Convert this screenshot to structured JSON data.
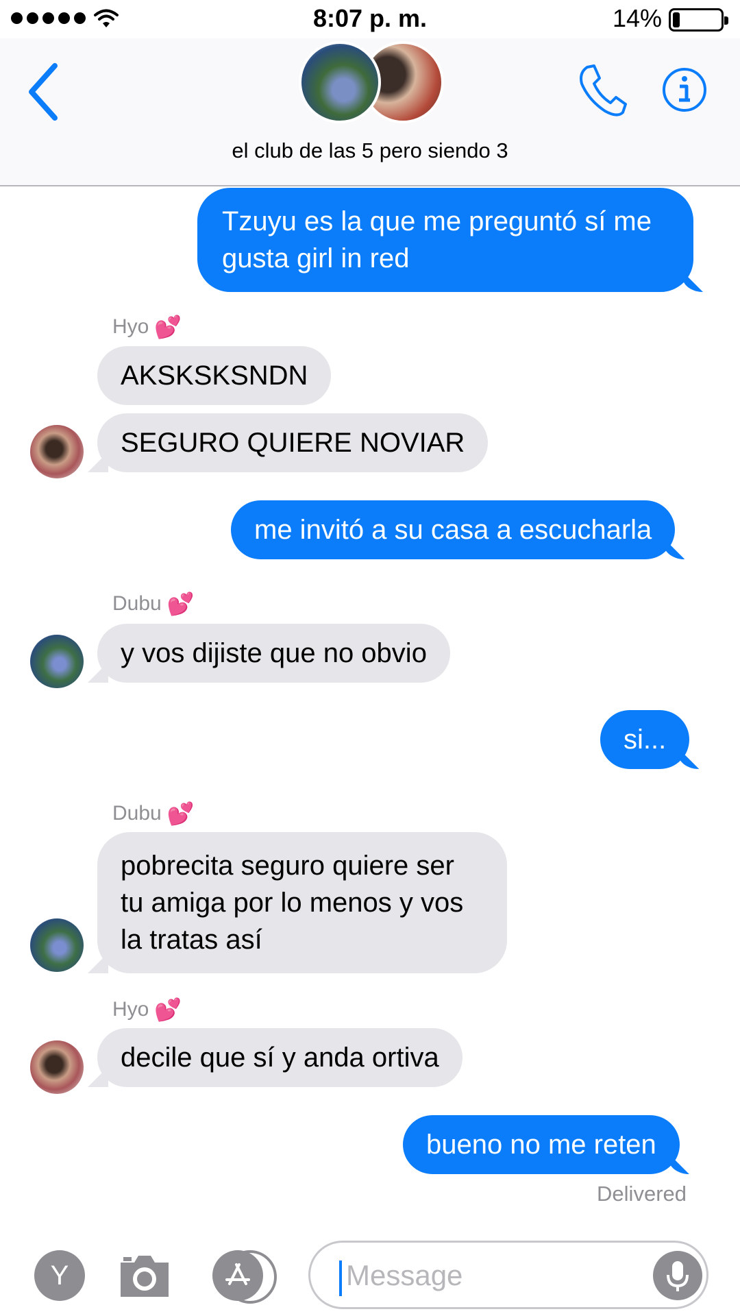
{
  "status_bar": {
    "time": "8:07 p. m.",
    "battery_percent": "14%",
    "battery_level": 0.14,
    "signal_dots": 5,
    "wifi_icon": "wifi-icon"
  },
  "header": {
    "group_name": "el club de las 5 pero siendo 3",
    "back_icon": "chevron-left-icon",
    "call_icon": "phone-icon",
    "info_icon": "info-icon",
    "accent_color": "#0b7dfb"
  },
  "messages": [
    {
      "direction": "outgoing",
      "text": "Tzuyu es la que me preguntó sí me gusta girl in red"
    },
    {
      "direction": "incoming",
      "sender": "Hyo",
      "text": "AKSKSKSNDN"
    },
    {
      "direction": "incoming",
      "sender": "Hyo",
      "text": "SEGURO QUIERE NOVIAR"
    },
    {
      "direction": "outgoing",
      "text": "me invitó a su casa a escucharla"
    },
    {
      "direction": "incoming",
      "sender": "Dubu",
      "text": "y vos dijiste que no obvio"
    },
    {
      "direction": "outgoing",
      "text": "si..."
    },
    {
      "direction": "incoming",
      "sender": "Dubu",
      "text": "pobrecita seguro quiere ser tu amiga por lo menos y vos la tratas así"
    },
    {
      "direction": "incoming",
      "sender": "Hyo",
      "text": "decile que sí y anda ortiva"
    },
    {
      "direction": "outgoing",
      "text": "bueno no me reten"
    }
  ],
  "sender_emoji": "💕",
  "delivered_label": "Delivered",
  "input": {
    "placeholder": "Message",
    "y_button_label": "Y",
    "camera_icon": "camera-icon",
    "appstore_icon": "app-store-icon",
    "mic_icon": "microphone-icon"
  },
  "colors": {
    "outgoing_bubble": "#0b7dfb",
    "incoming_bubble": "#e5e5ea"
  }
}
